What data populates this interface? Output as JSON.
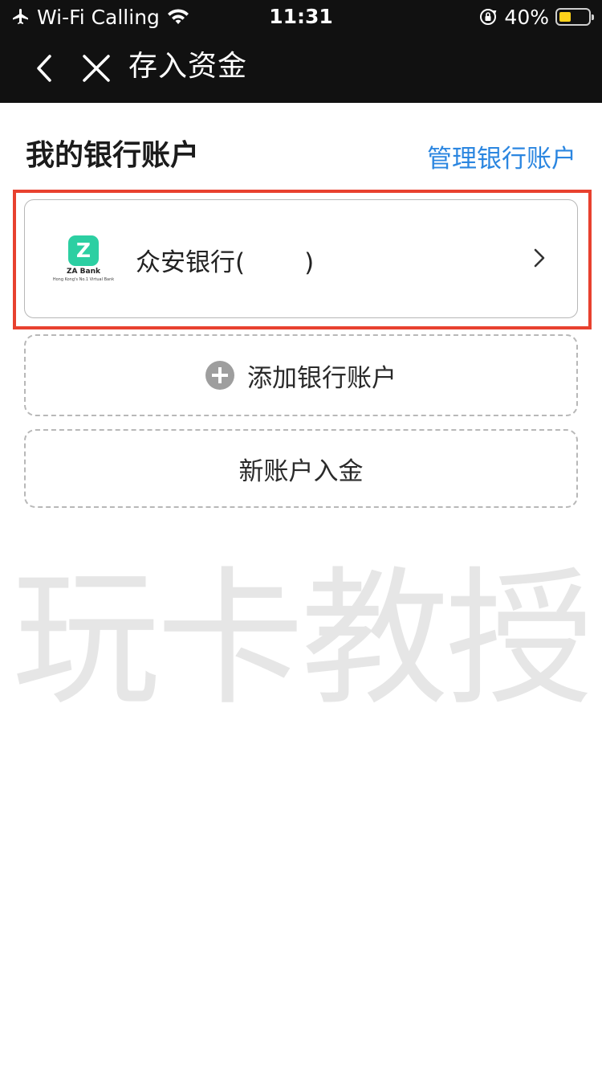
{
  "status_bar": {
    "carrier": "Wi-Fi Calling",
    "time": "11:31",
    "battery_text": "40%",
    "battery_level": 0.4,
    "battery_color": "#ffd21a",
    "icons": [
      "airplane-icon",
      "wifi-icon",
      "rotation-lock-icon",
      "battery-icon"
    ]
  },
  "nav": {
    "title": "存入资金",
    "back_icon": "chevron-left-icon",
    "close_icon": "close-icon"
  },
  "bank_section": {
    "title": "我的银行账户",
    "manage_link": "管理银行账户",
    "link_color": "#2b86e0"
  },
  "bank_card": {
    "logo_mark": "Z",
    "logo_name": "ZA Bank",
    "logo_tagline": "Hong Kong's No.1 Virtual Bank",
    "name": "众安银行",
    "paren_open": "(",
    "paren_close": ")",
    "highlight_color": "#e8412f"
  },
  "actions": {
    "add_bank": "添加银行账户",
    "new_account_deposit": "新账户入金"
  },
  "watermark": "玩卡教授"
}
